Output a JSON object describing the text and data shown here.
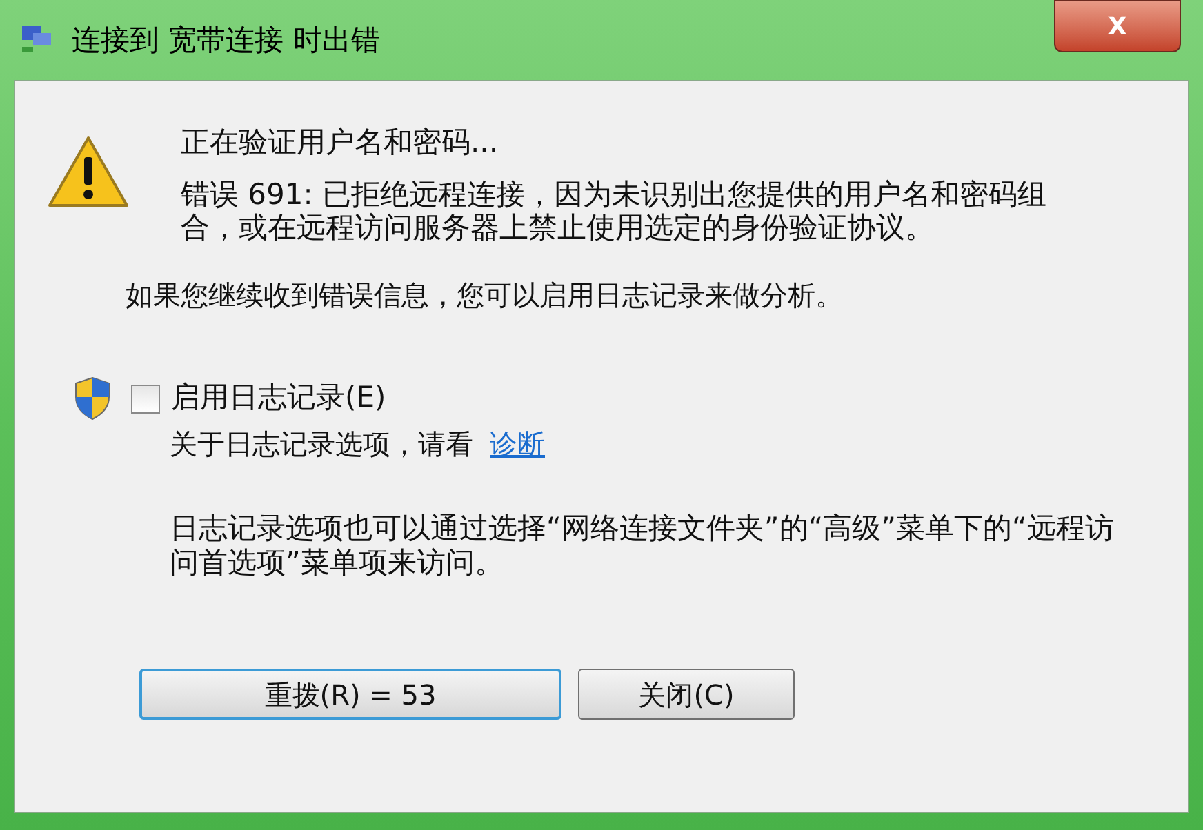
{
  "window": {
    "title": "连接到 宽带连接 时出错",
    "close": "X"
  },
  "status": "正在验证用户名和密码...",
  "error": "错误 691: 已拒绝远程连接，因为未识别出您提供的用户名和密码组合，或在远程访问服务器上禁止使用选定的身份验证协议。",
  "hint": "如果您继续收到错误信息，您可以启用日志记录来做分析。",
  "logging": {
    "label": "启用日志记录(E)",
    "checked": false
  },
  "see_text": "关于日志记录选项，请看",
  "link": "诊断",
  "note": "日志记录选项也可以通过选择“网络连接文件夹”的“高级”菜单下的“远程访问首选项”菜单项来访问。",
  "buttons": [
    {
      "label": "重拨(R) = 53",
      "default": true
    },
    {
      "label": "关闭(C)",
      "default": false
    }
  ]
}
